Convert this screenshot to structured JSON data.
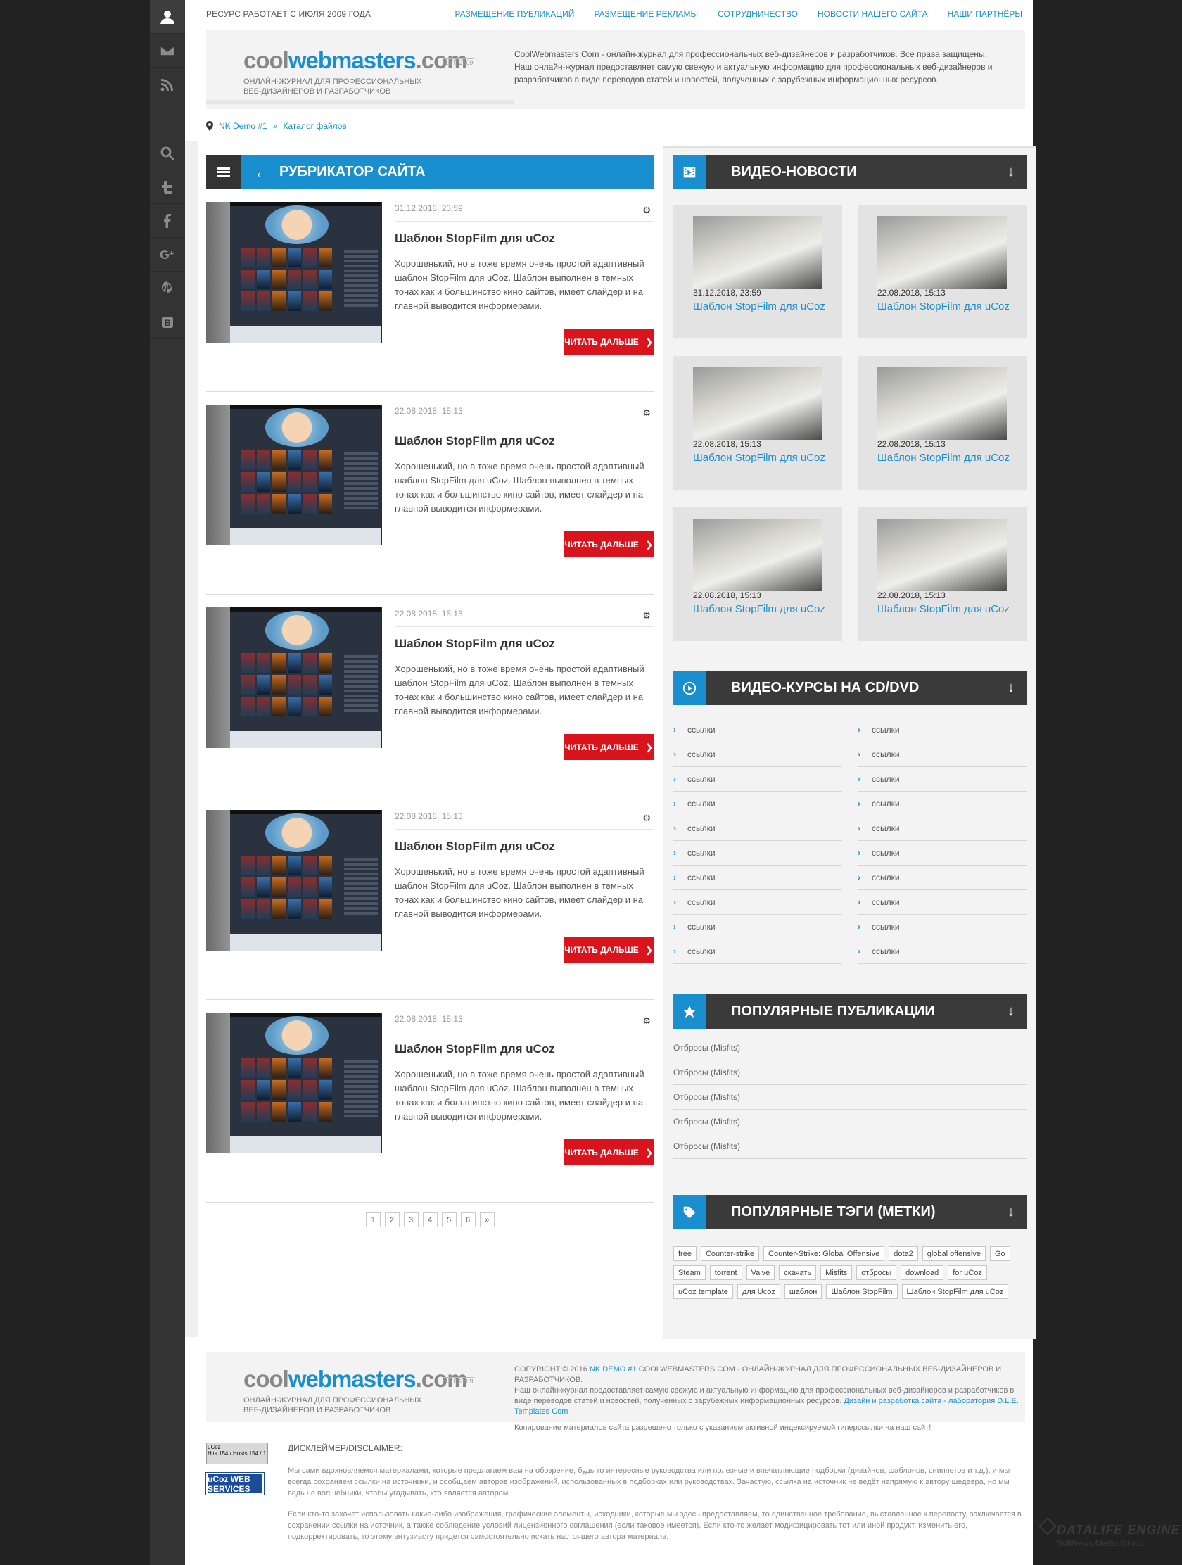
{
  "topbar": {
    "since": "Ресурс работает с июля 2009 года",
    "nav": [
      "Размещение публикаций",
      "Размещение рекламы",
      "Сотрудничество",
      "Новости нашего сайта",
      "Наши партнёры"
    ]
  },
  "logo": {
    "part1": "cool",
    "part2": "webmasters",
    "part3": ".com",
    "est": "EST. 2009",
    "tagline1": "Онлайн-журнал для профессиональных",
    "tagline2": "веб-дизайнеров и разработчиков"
  },
  "header": {
    "desc1": "CoolWebmasters Com - онлайн-журнал для профессиональных веб-дизайнеров и разработчиков. Все права защищены.",
    "desc2": "Наш онлайн-журнал предоставляет самую свежую и актуальную информацию для профессиональных веб-дизайнеров и разработчиков в виде переводов статей и новостей, полученных с зарубежных информационных ресурсов."
  },
  "breadcrumb": {
    "home": "NK Demo #1",
    "sep": "»",
    "current": "Каталог файлов"
  },
  "main": {
    "title": "Рубрикатор сайта",
    "posts": [
      {
        "date": "31.12.2018, 23:59",
        "title": "Шаблон StopFilm для uCoz",
        "desc": "Хорошенький, но в тоже время очень простой адаптивный шаблон StopFilm для uCoz. Шаблон выполнен в темных тонах как и большинство кино сайтов, имеет слайдер и на главной выводится информерами.",
        "more": "Читать дальше"
      },
      {
        "date": "22.08.2018, 15:13",
        "title": "Шаблон StopFilm для uCoz",
        "desc": "Хорошенький, но в тоже время очень простой адаптивный шаблон StopFilm для uCoz. Шаблон выполнен в темных тонах как и большинство кино сайтов, имеет слайдер и на главной выводится информерами.",
        "more": "Читать дальше"
      },
      {
        "date": "22.08.2018, 15:13",
        "title": "Шаблон StopFilm для uCoz",
        "desc": "Хорошенький, но в тоже время очень простой адаптивный шаблон StopFilm для uCoz. Шаблон выполнен в темных тонах как и большинство кино сайтов, имеет слайдер и на главной выводится информерами.",
        "more": "Читать дальше"
      },
      {
        "date": "22.08.2018, 15:13",
        "title": "Шаблон StopFilm для uCoz",
        "desc": "Хорошенький, но в тоже время очень простой адаптивный шаблон StopFilm для uCoz. Шаблон выполнен в темных тонах как и большинство кино сайтов, имеет слайдер и на главной выводится информерами.",
        "more": "Читать дальше"
      },
      {
        "date": "22.08.2018, 15:13",
        "title": "Шаблон StopFilm для uCoz",
        "desc": "Хорошенький, но в тоже время очень простой адаптивный шаблон StopFilm для uCoz. Шаблон выполнен в темных тонах как и большинство кино сайтов, имеет слайдер и на главной выводится информерами.",
        "more": "Читать дальше"
      }
    ],
    "pager": [
      "1",
      "2",
      "3",
      "4",
      "5",
      "6",
      "»"
    ]
  },
  "right": {
    "video_title": "Видео-новости",
    "videos": [
      {
        "date": "31.12.2018, 23:59",
        "title": "Шаблон StopFilm для uCoz"
      },
      {
        "date": "22.08.2018, 15:13",
        "title": "Шаблон StopFilm для uCoz"
      },
      {
        "date": "22.08.2018, 15:13",
        "title": "Шаблон StopFilm для uCoz"
      },
      {
        "date": "22.08.2018, 15:13",
        "title": "Шаблон StopFilm для uCoz"
      },
      {
        "date": "22.08.2018, 15:13",
        "title": "Шаблон StopFilm для uCoz"
      },
      {
        "date": "22.08.2018, 15:13",
        "title": "Шаблон StopFilm для uCoz"
      }
    ],
    "courses_title": "Видео-курсы на CD/DVD",
    "links": [
      "ссылки",
      "ссылки",
      "ссылки",
      "ссылки",
      "ссылки",
      "ссылки",
      "ссылки",
      "ссылки",
      "ссылки",
      "ссылки",
      "ссылки",
      "ссылки",
      "ссылки",
      "ссылки",
      "ссылки",
      "ссылки",
      "ссылки",
      "ссылки",
      "ссылки",
      "ссылки"
    ],
    "popular_title": "Популярные публикации",
    "popular": [
      "Отбросы (Misfits)",
      "Отбросы (Misfits)",
      "Отбросы (Misfits)",
      "Отбросы (Misfits)",
      "Отбросы (Misfits)"
    ],
    "tags_title": "Популярные тэги (метки)",
    "tags": [
      "free",
      "Counter-strike",
      "Counter-Strike: Global Offensive",
      "dota2",
      "global offensive",
      "Go",
      "Steam",
      "torrent",
      "Valve",
      "скачать",
      "Misfits",
      "отбросы",
      "download",
      "for uCoz",
      "uCoz template",
      "для Ucoz",
      "шаблон",
      "Шаблон StopFilm",
      "Шаблон StopFilm для uCoz"
    ]
  },
  "footer": {
    "copy_pre": "Copyright © 2016",
    "copy_link": "NK Demo #1",
    "copy_post": "CoolWebmasters Com - онлайн-журнал для профессиональных веб-дизайнеров и разработчиков.",
    "desc": "Наш онлайн-журнал предоставляет самую свежую и актуальную информацию для профессиональных веб-дизайнеров и разработчиков в виде переводов статей и новостей, полученных с зарубежных информационных ресурсов.",
    "desc_link": "Дизайн и разработка сайта - лаборатория D.L.E. Templates Com",
    "note": "Копирование материалов сайта разрешено только с указанием активной индексируемой гиперссылки на наш сайт!"
  },
  "disclaimer": {
    "counter_title": "uCoz",
    "counter_rows": "Hits 154 / Hosts 154 / 1",
    "badge": "uCoz WEB SERVICES",
    "title": "ДИСКЛЕЙМЕР/DISCLAIMER:",
    "p1": "Мы сами вдохновляемся материалами, которые предлагаем вам на обозрение, будь то интересные руководства или полезные и впечатляющие подборки (дизайнов, шаблонов, сниппетов и т.д.), и мы всегда сохраняем ссылки на источники, и сообщаем авторов изображений, использованных в подборках или руководствах. Зачастую, ссылка на источник не ведёт напрямую к автору шедевра, но мы ведь не волшебники, чтобы угадывать, кто является автором.",
    "p2": "Если кто-то захочет использовать какие-либо изображения, графические элементы, исходники, которые мы здесь предоставляем, то единственное требование, выставленное к перепосту, заключается в сохранении ссылки на источник, а также соблюдение условий лицензионного соглашения (если таковое имеется). Если кто-то желает модифицировать тот или иной продукт, изменить его, подкорректировать, то этому энтузиасту придется самостоятельно искать настоящего автора материала."
  },
  "watermark": {
    "line1": "DATALIFE ENGINE",
    "line2": "SoftNews Media Group"
  },
  "colors": {
    "accent": "#1a8fd0",
    "red": "#d9141d",
    "dark": "#333333"
  }
}
